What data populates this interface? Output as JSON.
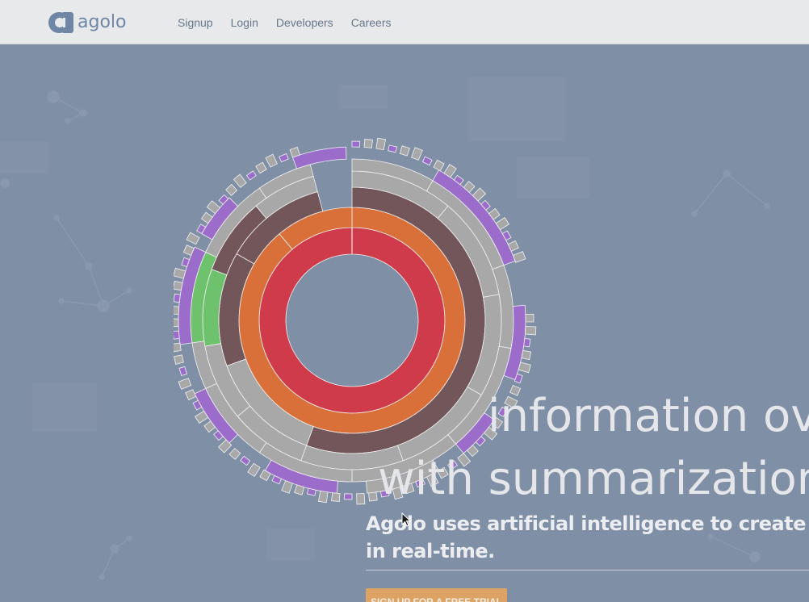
{
  "brand": {
    "name": "agolo",
    "accent": "#6f86a6"
  },
  "nav": {
    "items": [
      {
        "label": "Signup"
      },
      {
        "label": "Login"
      },
      {
        "label": "Developers"
      },
      {
        "label": "Careers"
      }
    ]
  },
  "hero": {
    "headline_line1": "information ove",
    "headline_line2": "with summarization",
    "subheadline_line1": "Agolo uses artificial intelligence to create sum",
    "subheadline_line2": "in real-time.",
    "cta_label": "SIGN UP FOR A FREE TRIAL",
    "cta_color": "#dca365",
    "background_color": "#7f8fa6"
  },
  "visualization": {
    "ring_colors": [
      "#d03b4b",
      "#d9703a",
      "#735659",
      "#a8a8a8",
      "#9c6cca",
      "#6fc26d"
    ]
  }
}
